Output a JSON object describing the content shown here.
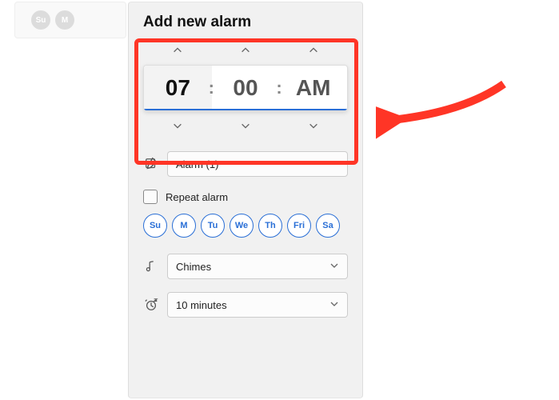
{
  "toolbar": {
    "pill1": "Su",
    "pill2": "M"
  },
  "panel": {
    "title": "Add new alarm"
  },
  "time": {
    "hour": "07",
    "minute": "00",
    "period": "AM"
  },
  "name": {
    "value": "Alarm (1)"
  },
  "repeat": {
    "label": "Repeat alarm",
    "checked": false
  },
  "days": [
    "Su",
    "M",
    "Tu",
    "We",
    "Th",
    "Fri",
    "Sa"
  ],
  "sound": {
    "value": "Chimes"
  },
  "snooze": {
    "value": "10 minutes"
  }
}
